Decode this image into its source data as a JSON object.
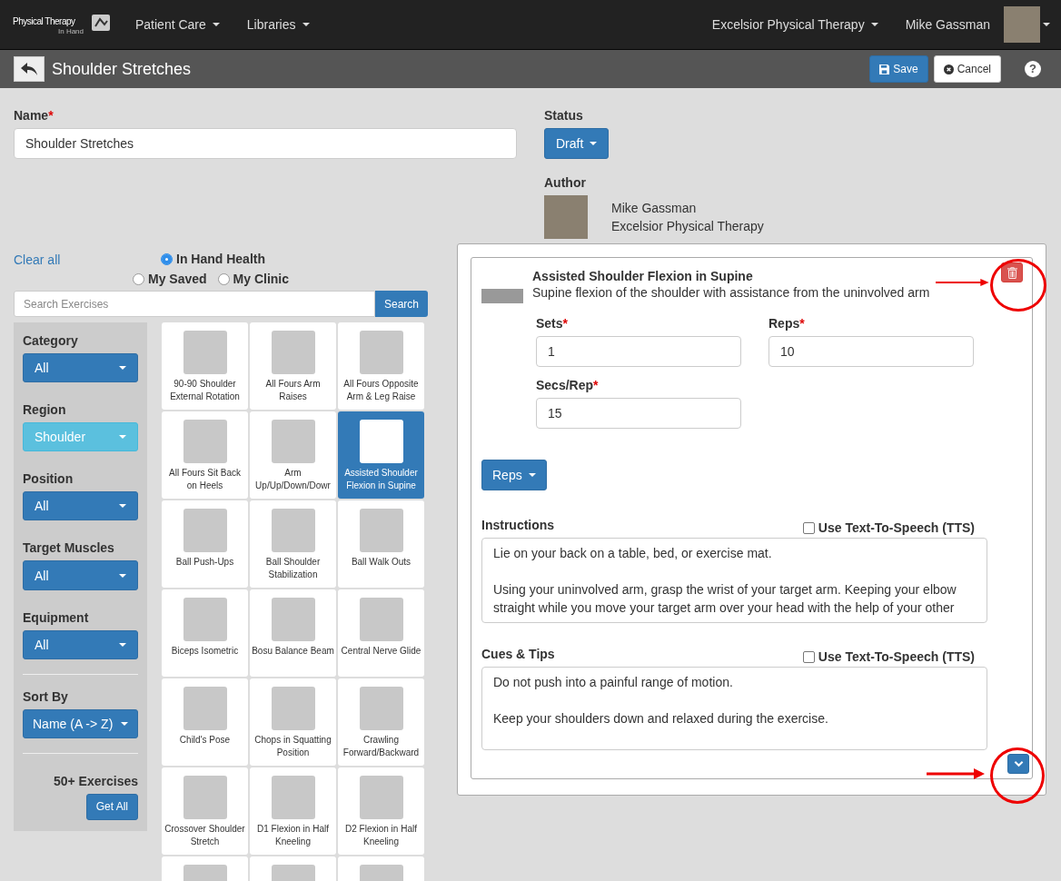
{
  "navbar": {
    "logo": {
      "line1": "Physical Therapy",
      "line2": "In Hand"
    },
    "menus": [
      {
        "label": "Patient Care"
      },
      {
        "label": "Libraries"
      }
    ],
    "clinic": "Excelsior Physical Therapy",
    "user": "Mike Gassman"
  },
  "toolbar": {
    "title": "Shoulder Stretches",
    "save": "Save",
    "cancel": "Cancel",
    "help": "?"
  },
  "name_field": {
    "label": "Name",
    "required_mark": "*",
    "value": "Shoulder Stretches"
  },
  "status": {
    "label": "Status",
    "value": "Draft"
  },
  "author": {
    "label": "Author",
    "name": "Mike Gassman",
    "clinic": "Excelsior Physical Therapy"
  },
  "library": {
    "clear_all": "Clear all",
    "sources": [
      {
        "label": "In Hand Health",
        "selected": true
      },
      {
        "label": "My Saved",
        "selected": false
      },
      {
        "label": "My Clinic",
        "selected": false
      }
    ],
    "search": {
      "placeholder": "Search Exercises",
      "button": "Search"
    }
  },
  "filters": [
    {
      "label": "Category",
      "value": "All",
      "active": false
    },
    {
      "label": "Region",
      "value": "Shoulder",
      "active": true
    },
    {
      "label": "Position",
      "value": "All",
      "active": false
    },
    {
      "label": "Target Muscles",
      "value": "All",
      "active": false
    },
    {
      "label": "Equipment",
      "value": "All",
      "active": false
    }
  ],
  "sort": {
    "label": "Sort By",
    "value": "Name (A -> Z)"
  },
  "count": "50+ Exercises",
  "get_all": "Get All",
  "exercises": [
    {
      "label": "90-90 Shoulder External Rotation",
      "selected": false
    },
    {
      "label": "All Fours Arm Raises",
      "selected": false
    },
    {
      "label": "All Fours Opposite Arm & Leg Raise",
      "selected": false
    },
    {
      "label": "All Fours Sit Back on Heels",
      "selected": false
    },
    {
      "label": "Arm Up/Up/Down/Dowr",
      "selected": false
    },
    {
      "label": "Assisted Shoulder Flexion in Supine",
      "selected": true
    },
    {
      "label": "Ball Push-Ups",
      "selected": false
    },
    {
      "label": "Ball Shoulder Stabilization",
      "selected": false
    },
    {
      "label": "Ball Walk Outs",
      "selected": false
    },
    {
      "label": "Biceps Isometric",
      "selected": false
    },
    {
      "label": "Bosu Balance Beam",
      "selected": false
    },
    {
      "label": "Central Nerve Glide",
      "selected": false
    },
    {
      "label": "Child's Pose",
      "selected": false
    },
    {
      "label": "Chops in Squatting Position",
      "selected": false
    },
    {
      "label": "Crawling Forward/Backward",
      "selected": false
    },
    {
      "label": "Crossover Shoulder Stretch",
      "selected": false
    },
    {
      "label": "D1 Flexion in Half Kneeling",
      "selected": false
    },
    {
      "label": "D2 Flexion in Half Kneeling",
      "selected": false
    }
  ],
  "detail": {
    "title": "Assisted Shoulder Flexion in Supine",
    "description": "Supine flexion of the shoulder with assistance from the uninvolved arm",
    "fields": [
      {
        "label": "Sets",
        "required_mark": "*",
        "value": "1"
      },
      {
        "label": "Reps",
        "required_mark": "*",
        "value": "10"
      },
      {
        "label": "Secs/Rep",
        "required_mark": "*",
        "value": "15"
      }
    ],
    "mode": "Reps",
    "texts": [
      {
        "label": "Instructions",
        "tts_label": "Use Text-To-Speech (TTS)",
        "tts": false,
        "paragraphs": [
          "Lie on your back on a table, bed, or exercise mat.",
          "Using your uninvolved arm, grasp the wrist of your target arm. Keeping your elbow straight while you move your target arm over your head with the help of your other"
        ]
      },
      {
        "label": "Cues & Tips",
        "tts_label": "Use Text-To-Speech (TTS)",
        "tts": false,
        "paragraphs": [
          "Do not push into a painful range of motion.",
          "Keep your shoulders down and relaxed during the exercise."
        ]
      }
    ]
  }
}
